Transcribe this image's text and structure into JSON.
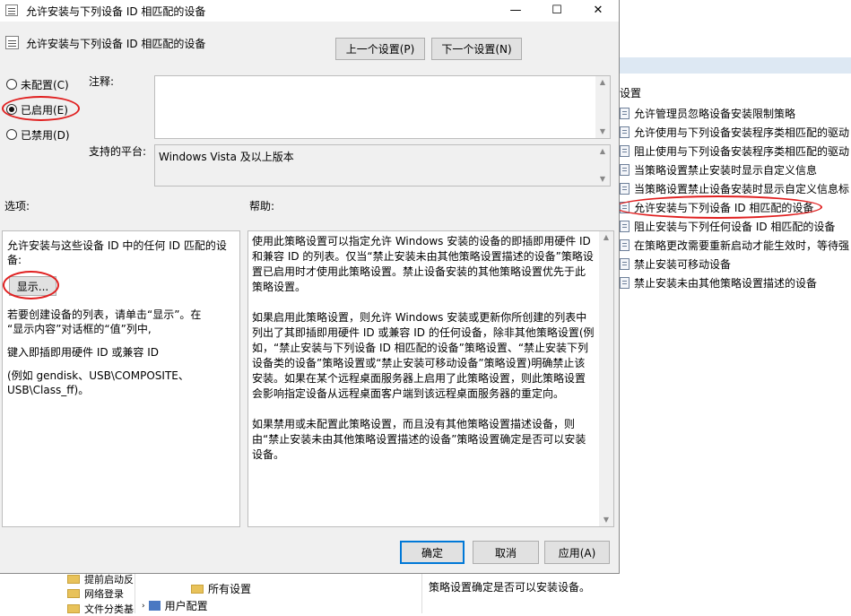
{
  "dialog": {
    "title": "允许安装与下列设备 ID 相匹配的设备",
    "header_title": "允许安装与下列设备 ID 相匹配的设备",
    "prev_button": "上一个设置(P)",
    "next_button": "下一个设置(N)",
    "window_controls": {
      "minimize": "—",
      "maximize": "☐",
      "close": "✕"
    },
    "state": {
      "not_configured": "未配置(C)",
      "enabled": "已启用(E)",
      "disabled": "已禁用(D)",
      "selected": "enabled"
    },
    "comment_label": "注释:",
    "platform_label": "支持的平台:",
    "platform_value": "Windows Vista 及以上版本",
    "options_label": "选项:",
    "help_label": "帮助:",
    "options": {
      "line1": "允许安装与这些设备 ID 中的任何 ID 匹配的设",
      "line2": "备:",
      "show_button": "显示...",
      "text1_a": "若要创建设备的列表，请单击“显示”。在",
      "text1_b": "“显示内容”对话框的“值”列中,",
      "text2": "键入即插即用硬件 ID 或兼容 ID",
      "text3_a": "(例如 gendisk、USB\\COMPOSITE、",
      "text3_b": "USB\\Class_ff)。"
    },
    "help": {
      "p1": "使用此策略设置可以指定允许 Windows 安装的设备的即插即用硬件 ID 和兼容 ID 的列表。仅当“禁止安装未由其他策略设置描述的设备”策略设置已启用时才使用此策略设置。禁止设备安装的其他策略设置优先于此策略设置。",
      "p2": "如果启用此策略设置，则允许 Windows 安装或更新你所创建的列表中列出了其即插即用硬件 ID 或兼容 ID 的任何设备，除非其他策略设置(例如，“禁止安装与下列设备 ID 相匹配的设备”策略设置、“禁止安装下列设备类的设备”策略设置或“禁止安装可移动设备”策略设置)明确禁止该安装。如果在某个远程桌面服务器上启用了此策略设置，则此策略设置会影响指定设备从远程桌面客户端到该远程桌面服务器的重定向。",
      "p3": "如果禁用或未配置此策略设置，而且没有其他策略设置描述设备，则由“禁止安装未由其他策略设置描述的设备”策略设置确定是否可以安装设备。"
    },
    "ok_button": "确定",
    "cancel_button": "取消",
    "apply_button": "应用(A)"
  },
  "background": {
    "settings_header": "设置",
    "policy_items": [
      "允许管理员忽略设备安装限制策略",
      "允许使用与下列设备安装程序类相匹配的驱动",
      "阻止使用与下列设备安装程序类相匹配的驱动",
      "当策略设置禁止安装时显示自定义信息",
      "当策略设置禁止设备安装时显示自定义信息标",
      "允许安装与下列设备 ID 相匹配的设备",
      "阻止安装与下列任何设备 ID 相匹配的设备",
      "在策略更改需要重新启动才能生效时，等待强",
      "禁止安装可移动设备",
      "禁止安装未由其他策略设置描述的设备"
    ],
    "tree": {
      "item_early": "提前启动反",
      "item_netlogon": "网络登录",
      "item_fileclass": "文件分类基",
      "all_settings": "所有设置",
      "user_config": "用户配置"
    },
    "bottom_desc": "策略设置确定是否可以安装设备。"
  }
}
